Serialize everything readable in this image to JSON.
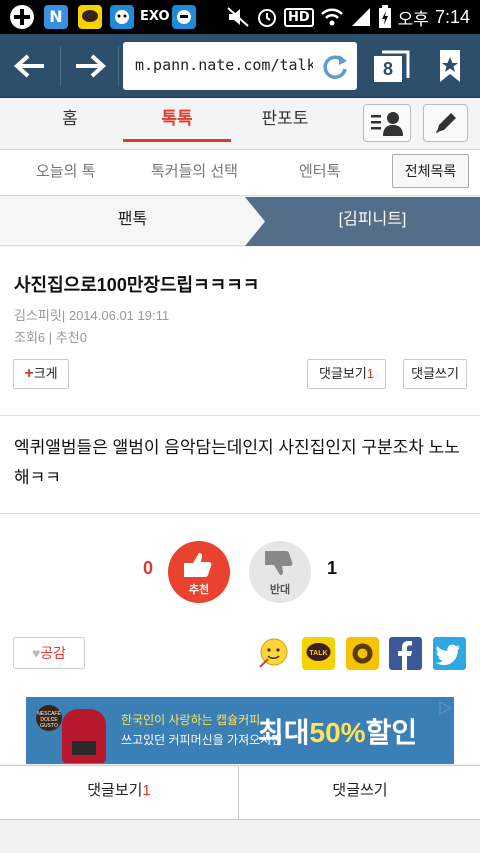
{
  "status_bar": {
    "ampm": "오후",
    "time": "7:14",
    "hd_label": "HD",
    "icons": [
      "add-icon",
      "n-app-icon",
      "kakaotalk-icon",
      "app-icon",
      "exo-icon",
      "app-icon-2",
      "mute-icon",
      "alarm-icon",
      "hd-icon",
      "wifi-icon",
      "signal-icon",
      "battery-icon"
    ]
  },
  "browser": {
    "url": "m.pann.nate.com/talk/",
    "tab_count": "8"
  },
  "site_nav": {
    "tabs": [
      {
        "label": "홈"
      },
      {
        "label": "톡톡"
      },
      {
        "label": "판포토"
      }
    ]
  },
  "sub_nav": {
    "tabs": [
      {
        "label": "오늘의 톡"
      },
      {
        "label": "톡커들의 선택"
      },
      {
        "label": "엔터톡"
      }
    ],
    "all_button": "전체목록"
  },
  "category": {
    "left": "팬톡",
    "right": "[김피니트]"
  },
  "post": {
    "title": "사진집으로100만장드립ㅋㅋㅋㅋ",
    "author": "김스피릿",
    "date": "2014.06.01 19:11",
    "views_label": "조회",
    "views": "6",
    "recommend_label": "추천",
    "recommend": "0",
    "enlarge_button": "크게",
    "comments_view_label": "댓글보기",
    "comments_count": "1",
    "comments_write_label": "댓글쓰기",
    "body": "엑퀴앨범들은 앨범이 음악담는데인지 사진집인지 구분조차 노노해ㅋㅋ"
  },
  "votes": {
    "up_count": "0",
    "up_label": "추천",
    "down_count": "1",
    "down_label": "반대"
  },
  "share": {
    "like_label": "공감",
    "icons": [
      "emoticon-icon",
      "kakaotalk-share-icon",
      "kakaostory-share-icon",
      "facebook-share-icon",
      "twitter-share-icon"
    ]
  },
  "ad": {
    "line1": "한국인이 사랑하는 캡슐커피",
    "line2": "쓰고있던 커피머신을 가져오시면",
    "headline_prefix": "최대",
    "headline_highlight": "50%",
    "headline_suffix": "할인",
    "brand": "NESCAFÉ DOLCE GUSTO"
  },
  "bottom": {
    "comments_view_label": "댓글보기",
    "comments_count": "1",
    "comments_write_label": "댓글쓰기"
  },
  "colors": {
    "brand_red": "#e03a2f",
    "browser_bar": "#2d4f6c",
    "category_active": "#546e8a"
  }
}
